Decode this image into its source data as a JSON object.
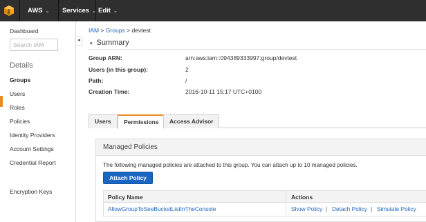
{
  "topbar": {
    "brand": "AWS",
    "services": "Services",
    "edit": "Edit",
    "caret": "⌄",
    "colors": {
      "background": "#2f2f2f",
      "logo": "#f7a80d"
    }
  },
  "sidebar": {
    "dashboard": "Dashboard",
    "search_placeholder": "Search IAM",
    "details_heading": "Details",
    "items": [
      "Groups",
      "Users",
      "Roles",
      "Policies",
      "Identity Providers",
      "Account Settings",
      "Credential Report"
    ],
    "active_item": "Groups",
    "encryption_keys": "Encryption Keys",
    "collapse_glyph": "◂"
  },
  "breadcrumb": {
    "iam": "IAM",
    "sep": ">",
    "groups": "Groups",
    "current": "devtest"
  },
  "summary": {
    "title": "Summary",
    "toggle_glyph": "▾",
    "rows": [
      {
        "label": "Group ARN:",
        "value": "arn:aws:iam::094389333997:group/devtest"
      },
      {
        "label": "Users (in this group):",
        "value": "2"
      },
      {
        "label": "Path:",
        "value": "/"
      },
      {
        "label": "Creation Time:",
        "value": "2016-10-11 15:17 UTC+0100"
      }
    ]
  },
  "tabs": [
    {
      "label": "Users",
      "selected": false
    },
    {
      "label": "Permissions",
      "selected": true
    },
    {
      "label": "Access Advisor",
      "selected": false
    }
  ],
  "managed_policies": {
    "title": "Managed Policies",
    "description": "The following managed policies are attached to this group. You can attach up to 10 managed policies.",
    "attach_button": "Attach Policy",
    "table": {
      "columns": [
        "Policy Name",
        "Actions"
      ],
      "rows": [
        {
          "policy_name": "AllowGroupToSeeBucketListInTheConsole",
          "actions": [
            "Show Policy",
            "Detach Policy",
            "Simulate Policy"
          ],
          "separator": "|"
        }
      ]
    }
  },
  "colors": {
    "accent": "#e88b20",
    "link": "#2266bb",
    "button": "#1a66c2"
  }
}
